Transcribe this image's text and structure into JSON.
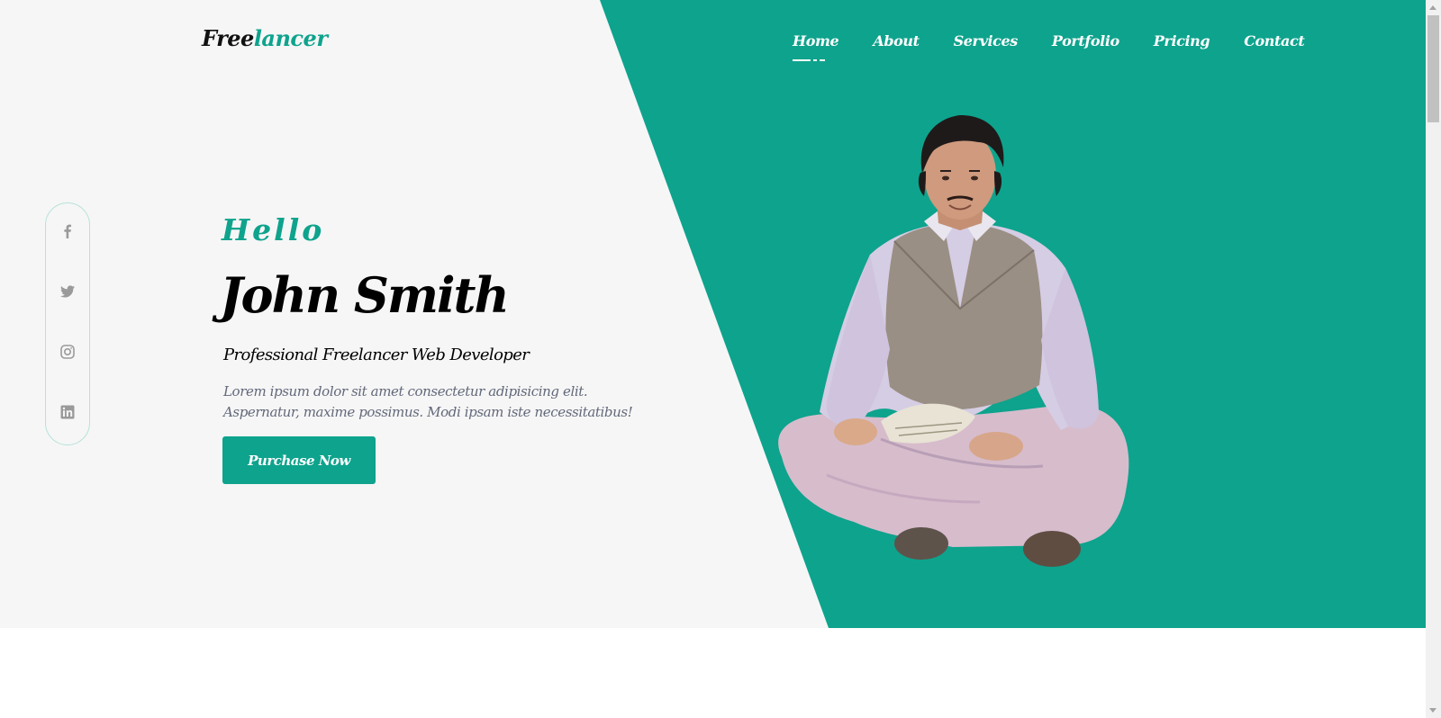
{
  "brand": {
    "part1": "Free",
    "part2": "lancer"
  },
  "nav": [
    {
      "label": "Home",
      "active": true
    },
    {
      "label": "About"
    },
    {
      "label": "Services"
    },
    {
      "label": "Portfolio"
    },
    {
      "label": "Pricing"
    },
    {
      "label": "Contact"
    }
  ],
  "social": [
    "facebook-icon",
    "twitter-icon",
    "instagram-icon",
    "linkedin-icon"
  ],
  "hero": {
    "greeting": "Hello",
    "name": "John Smith",
    "title": "Professional Freelancer Web Developer",
    "description": "Lorem ipsum dolor sit amet consectetur adipisicing elit. Aspernatur, maxime possimus. Modi ipsam iste necessitatibus!",
    "cta": "Purchase Now"
  },
  "colors": {
    "accent": "#0ea38d",
    "hero_bg": "#f6f6f6",
    "text": "#000000",
    "muted": "#62687a"
  }
}
